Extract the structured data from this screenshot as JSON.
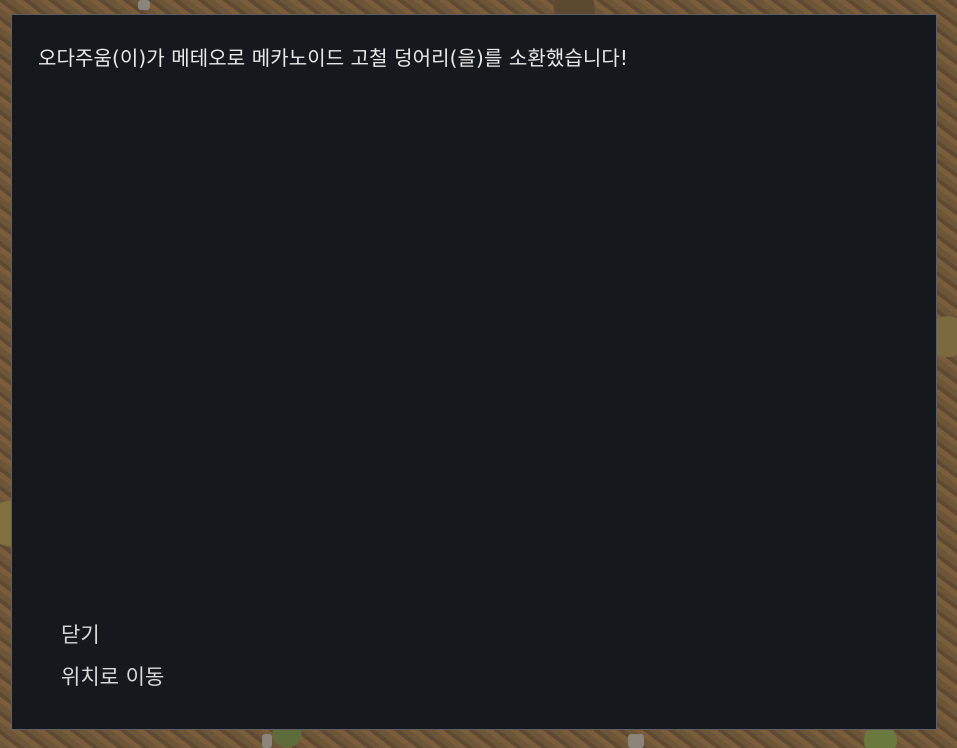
{
  "dialog": {
    "message": "오다주움(이)가 메테오로 메카노이드 고철 덩어리(을)를 소환했습니다!",
    "options": [
      {
        "label": "닫기"
      },
      {
        "label": "위치로 이동"
      }
    ]
  },
  "colors": {
    "dialog_bg": "#15181d",
    "dialog_border": "#5d6167",
    "text": "#e8e8e8"
  }
}
